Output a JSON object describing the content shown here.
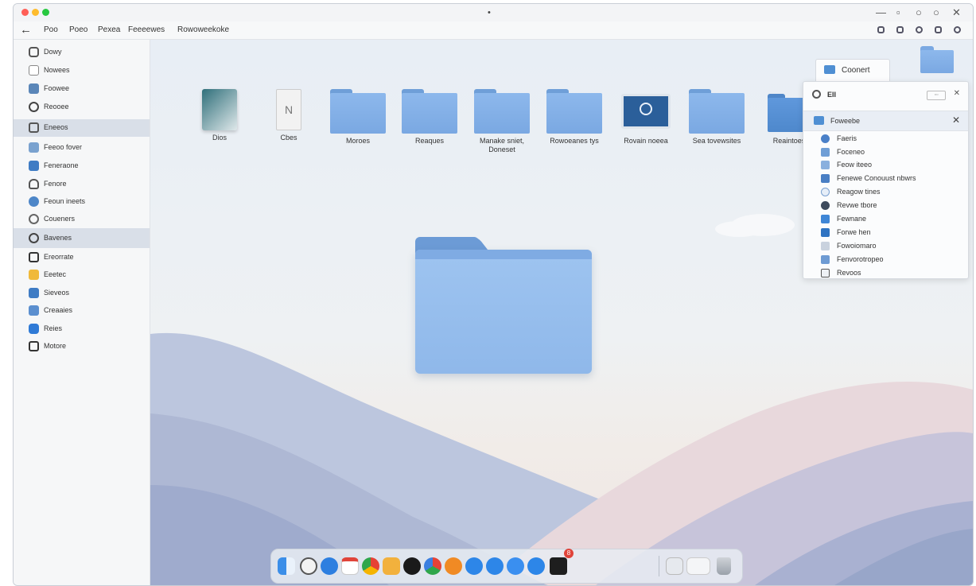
{
  "window": {
    "title": "•",
    "controls": [
      "—",
      "▫",
      "○",
      "○",
      "✕"
    ]
  },
  "toolbar": {
    "back_label": "←",
    "crumbs": [
      "Poo",
      "Poeo",
      "Pexea",
      "Feeeewes",
      "Rowoweekoke"
    ]
  },
  "sidebar": {
    "items": [
      {
        "label": "Dowy",
        "icon": "briefcase-icon"
      },
      {
        "label": "Nowees",
        "icon": "document-icon"
      },
      {
        "label": "Foowee",
        "icon": "image-icon"
      },
      {
        "label": "Reooee",
        "icon": "clock-icon"
      },
      {
        "label": "Eneeos",
        "icon": "folder-icon"
      },
      {
        "label": "Feeoo fover",
        "icon": "photo-icon"
      },
      {
        "label": "Feneraone",
        "icon": "monitor-icon"
      },
      {
        "label": "Fenore",
        "icon": "cloud-icon"
      },
      {
        "label": "Feoun ineets",
        "icon": "network-icon"
      },
      {
        "label": "Coueners",
        "icon": "globe-icon"
      },
      {
        "label": "Bavenes",
        "icon": "info-icon"
      },
      {
        "label": "Ereorrate",
        "icon": "box-icon"
      },
      {
        "label": "Eeetec",
        "icon": "tag-icon"
      },
      {
        "label": "Sieveos",
        "icon": "monitor-icon"
      },
      {
        "label": "Creaaies",
        "icon": "list-icon"
      },
      {
        "label": "Reies",
        "icon": "app-icon"
      },
      {
        "label": "Motore",
        "icon": "box-icon"
      }
    ]
  },
  "desktop": {
    "items": [
      {
        "label": "Dios",
        "type": "app-preview"
      },
      {
        "label": "Cbes",
        "type": "document"
      },
      {
        "label": "Moroes",
        "type": "folder"
      },
      {
        "label": "Reaques",
        "type": "folder"
      },
      {
        "label": "Manake sniet, Doneset",
        "type": "folder"
      },
      {
        "label": "Rowoeanes tys",
        "type": "folder"
      },
      {
        "label": "Rovain noeea",
        "type": "monitor"
      },
      {
        "label": "Sea tovewsites",
        "type": "folder"
      },
      {
        "label": "Reaintoes",
        "type": "folder"
      }
    ]
  },
  "panel": {
    "tab_label": "Coonert",
    "header_label": "EII",
    "header_badge": "▫▫",
    "selected_label": "Foweebe",
    "items": [
      {
        "label": "Faeris",
        "icon": "users-icon"
      },
      {
        "label": "Foceneo",
        "icon": "camera-icon"
      },
      {
        "label": "Feow iteeo",
        "icon": "image-icon"
      },
      {
        "label": "Fenewe Conouust nbwrs",
        "icon": "list-icon"
      },
      {
        "label": "Reagow tines",
        "icon": "circle-icon"
      },
      {
        "label": "Revwe tbore",
        "icon": "disc-icon"
      },
      {
        "label": "Fewnane",
        "icon": "app-icon"
      },
      {
        "label": "Forwe hen",
        "icon": "calendar-icon"
      },
      {
        "label": "Fowoiomaro",
        "icon": "image-icon"
      },
      {
        "label": "Fenvorotropeo",
        "icon": "photo-icon"
      },
      {
        "label": "Revoos",
        "icon": "box-icon"
      }
    ]
  },
  "dock": {
    "badge_count": "8"
  },
  "colors": {
    "accent": "#4f8fd3",
    "folder": "#8db8ec",
    "selection": "#d9dfe8"
  }
}
